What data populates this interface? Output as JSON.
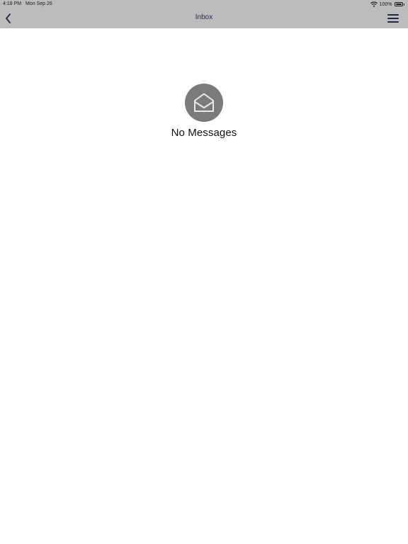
{
  "status_bar": {
    "time": "4:18 PM",
    "date": "Mon Sep 26",
    "battery": "100%",
    "battery_level": 1.0
  },
  "nav": {
    "title": "Inbox",
    "back_icon": "chevron-left-icon",
    "menu_icon": "hamburger-menu-icon"
  },
  "empty_state": {
    "icon": "open-envelope-icon",
    "message": "No Messages"
  },
  "colors": {
    "topbar_background": "#bcbcbc",
    "nav_icon": "#1f2a4a",
    "empty_icon_background": "#7b7b7b"
  }
}
